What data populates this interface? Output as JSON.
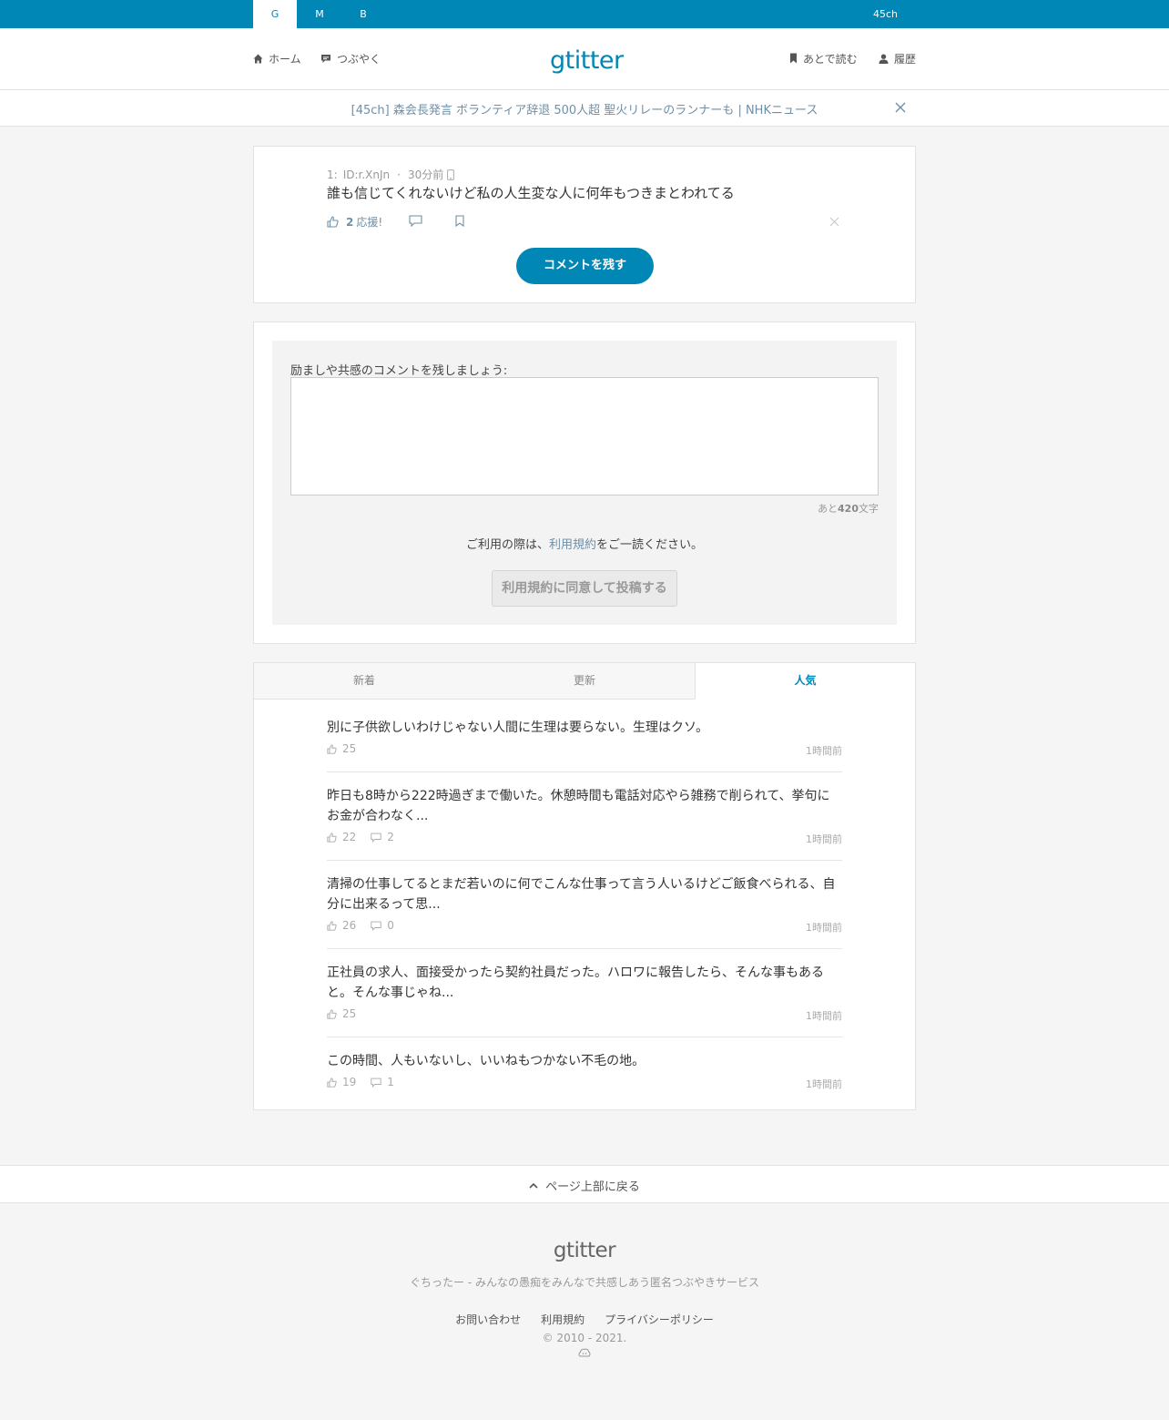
{
  "topbar": {
    "tabs": [
      {
        "label": "G",
        "active": true
      },
      {
        "label": "M",
        "active": false
      },
      {
        "label": "B",
        "active": false
      }
    ],
    "right_link": "45ch"
  },
  "header": {
    "logo": "gtitter",
    "nav_left": [
      {
        "label": "ホーム",
        "icon": "home-icon"
      },
      {
        "label": "つぶやく",
        "icon": "speech-bubble-icon"
      }
    ],
    "nav_right": [
      {
        "label": "あとで読む",
        "icon": "bookmark-icon"
      },
      {
        "label": "履歴",
        "icon": "user-icon"
      }
    ]
  },
  "banner": {
    "text": "[45ch] 森会長発言 ボランティア辞退 500人超 聖火リレーのランナーも | NHKニュース"
  },
  "post": {
    "number": "1:",
    "user_id": "ID:r.XnJn",
    "separator": "·",
    "time": "30分前",
    "text": "誰も信じてくれないけど私の人生変な人に何年もつきまとわれてる",
    "likes": "2",
    "likes_label": "応援!",
    "comment_button": "コメントを残す"
  },
  "comment_form": {
    "label": "励ましや共感のコメントを残しましょう:",
    "textarea_value": "",
    "char_prefix": "あと",
    "char_remaining": "420",
    "char_suffix": "文字",
    "terms_prefix": "ご利用の際は、",
    "terms_link": "利用規約",
    "terms_suffix": "をご一読ください。",
    "submit": "利用規約に同意して投稿する"
  },
  "feed": {
    "tabs": [
      {
        "label": "新着",
        "active": false
      },
      {
        "label": "更新",
        "active": false
      },
      {
        "label": "人気",
        "active": true
      }
    ],
    "items": [
      {
        "text": "別に子供欲しいわけじゃない人間に生理は要らない。生理はクソ。",
        "likes": "25",
        "comments": null,
        "time": "1時間前"
      },
      {
        "text": "昨日も8時から222時過ぎまで働いた。休憩時間も電話対応やら雑務で削られて、挙句にお金が合わなく...",
        "likes": "22",
        "comments": "2",
        "time": "1時間前"
      },
      {
        "text": "清掃の仕事してるとまだ若いのに何でこんな仕事って言う人いるけどご飯食べられる、自分に出来るって思...",
        "likes": "26",
        "comments": "0",
        "time": "1時間前"
      },
      {
        "text": "正社員の求人、面接受かったら契約社員だった。ハロワに報告したら、そんな事もあると。そんな事じゃね...",
        "likes": "25",
        "comments": null,
        "time": "1時間前"
      },
      {
        "text": "この時間、人もいないし、いいねもつかない不毛の地。",
        "likes": "19",
        "comments": "1",
        "time": "1時間前"
      }
    ]
  },
  "back_to_top": "ページ上部に戻る",
  "footer": {
    "logo": "gtitter",
    "tagline": "ぐちったー - みんなの愚痴をみんなで共感しあう匿名つぶやきサービス",
    "links": [
      "お問い合わせ",
      "利用規約",
      "プライバシーポリシー"
    ],
    "copyright": "© 2010 - 2021."
  },
  "colors": {
    "brand": "#0087b5",
    "link": "#6f8fa6",
    "background": "#f5f5f5"
  }
}
